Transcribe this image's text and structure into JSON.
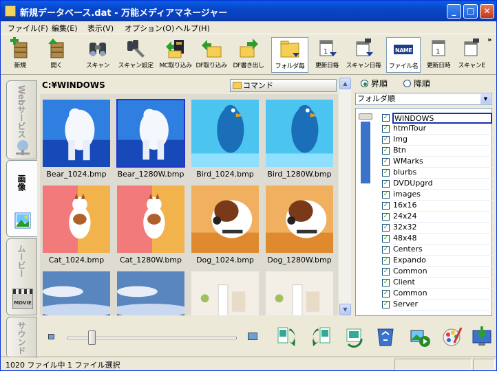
{
  "window": {
    "title": "新規データベース.dat - 万能メディアマネージャー",
    "minimize": "_",
    "maximize": "□",
    "close": "✕"
  },
  "menu": [
    "ファイル(F)",
    "編集(E)",
    "表示(V)",
    "オプション(O)",
    "ヘルプ(H)"
  ],
  "toolbar": {
    "new": "新規",
    "open": "開く",
    "scan": "スキャン",
    "scan_settings": "スキャン設定",
    "mc_import": "MC取り込み",
    "df_import": "DF取り込み",
    "df_export": "DF書き出し",
    "by_folder": "フォルダ毎",
    "by_update_date": "更新日毎",
    "by_scan_date": "スキャン日毎",
    "file_name": "ファイル名",
    "update_datetime": "更新日時",
    "scan_e": "スキャンE",
    "overflow": "»",
    "name_badge": "NAME"
  },
  "sidebar": {
    "web": "Webサービス",
    "image": "画像",
    "movie": "ムービー",
    "sound": "サウンド",
    "movie_badge": "MOVIE"
  },
  "content": {
    "path": "C:¥WINDOWS",
    "command": "コマンド",
    "files": [
      {
        "name": "Bear_1024.bmp",
        "kind": "bear"
      },
      {
        "name": "Bear_1280W.bmp",
        "kind": "bear",
        "selected": true
      },
      {
        "name": "Bird_1024.bmp",
        "kind": "bird"
      },
      {
        "name": "Bird_1280W.bmp",
        "kind": "bird"
      },
      {
        "name": "Cat_1024.bmp",
        "kind": "cat"
      },
      {
        "name": "Cat_1280W.bmp",
        "kind": "cat"
      },
      {
        "name": "Dog_1024.bmp",
        "kind": "dog"
      },
      {
        "name": "Dog_1280W.bmp",
        "kind": "dog"
      },
      {
        "name": "",
        "kind": "sky"
      },
      {
        "name": "",
        "kind": "sky"
      },
      {
        "name": "",
        "kind": "room"
      },
      {
        "name": "",
        "kind": "room"
      }
    ]
  },
  "sort": {
    "ascending": "昇順",
    "descending": "降順",
    "order_value": "フォルダ順"
  },
  "folders": [
    "WINDOWS",
    "htmlTour",
    "Img",
    "Btn",
    "WMarks",
    "blurbs",
    "DVDUpgrd",
    "images",
    "16x16",
    "24x24",
    "32x32",
    "48x48",
    "Centers",
    "Expando",
    "Common",
    "Client",
    "Common",
    "Server"
  ],
  "status": {
    "text": "1020 ファイル中 1 ファイル選択"
  }
}
